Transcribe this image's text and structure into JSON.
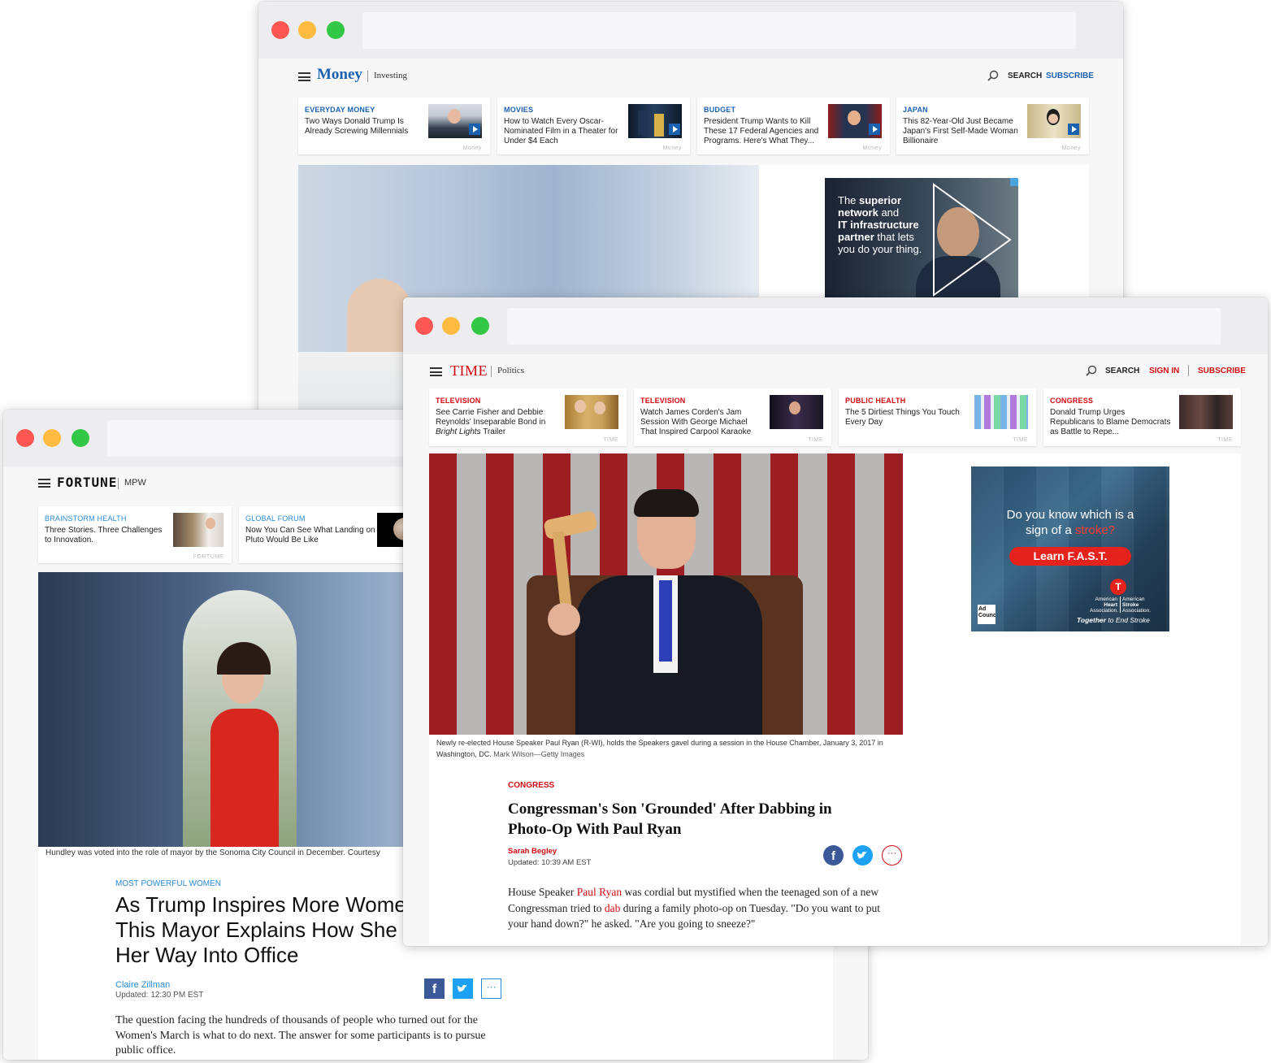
{
  "money": {
    "logo": "Money",
    "section": "Investing",
    "search_label": "SEARCH",
    "subscribe_label": "SUBSCRIBE",
    "cards": [
      {
        "kicker": "EVERYDAY MONEY",
        "headline": "Two Ways Donald Trump Is Already Screwing Millennials",
        "source": "Money"
      },
      {
        "kicker": "MOVIES",
        "headline": "How to Watch Every Oscar-Nominated Film in a Theater for Under $4 Each",
        "source": "Money"
      },
      {
        "kicker": "BUDGET",
        "headline": "President Trump Wants to Kill These 17 Federal Agencies and Programs. Here's What They...",
        "source": "Money"
      },
      {
        "kicker": "JAPAN",
        "headline": "This 82-Year-Old Just Became Japan's First Self-Made Woman Billionaire",
        "source": "Money"
      }
    ],
    "ad": {
      "line1": "The ",
      "line1b": "superior",
      "line2": "network",
      "line2b": " and",
      "line3": "IT infrastructure",
      "line4": "partner",
      "line4b": " that lets",
      "line5": "you do your thing."
    }
  },
  "fortune": {
    "logo": "FORTUNE",
    "section": "MPW",
    "cards": [
      {
        "kicker": "BRAINSTORM HEALTH",
        "headline": "Three Stories. Three Challenges to Innovation.",
        "source": "FORTUNE"
      },
      {
        "kicker": "GLOBAL FORUM",
        "headline": "Now You Can See What Landing on Pluto Would Be Like",
        "source": "FORTUNE"
      }
    ],
    "caption": "Hundley was voted into the role of mayor by the Sonoma City Council in December.  Courtesy",
    "kicker": "MOST POWERFUL WOMEN",
    "title_line1": "As Trump Inspires More Wome",
    "title_line2": "This Mayor Explains How She",
    "title_line3": "Her Way Into Office",
    "author": "Claire Zillman",
    "updated": "Updated: 12:30 PM EST",
    "body": "The question facing the hundreds of thousands of people who turned out for the Women's March is what to do next. The answer for some participants is to pursue public office."
  },
  "time": {
    "logo": "TIME",
    "section": "Politics",
    "search_label": "SEARCH",
    "signin_label": "SIGN IN",
    "subscribe_label": "SUBSCRIBE",
    "cards": [
      {
        "kicker": "TELEVISION",
        "headline_a": "See Carrie Fisher and Debbie Reynolds' Inseparable Bond in ",
        "headline_em": "Bright Lights",
        "headline_b": " Trailer",
        "source": "TIME"
      },
      {
        "kicker": "TELEVISION",
        "headline": "Watch James Corden's Jam Session With George Michael That Inspired Carpool Karaoke",
        "source": "TIME"
      },
      {
        "kicker": "PUBLIC HEALTH",
        "headline": "The 5 Dirtiest Things You Touch Every Day",
        "source": "TIME"
      },
      {
        "kicker": "CONGRESS",
        "headline": "Donald Trump Urges Republicans to Blame Democrats as Battle to Repe...",
        "source": "TIME"
      }
    ],
    "caption": "Newly re-elected House Speaker Paul Ryan (R-WI), holds the Speakers gavel during a session in the House Chamber, January 3, 2017 in Washington, DC.",
    "credit": "Mark Wilson—Getty Images",
    "kicker": "CONGRESS",
    "title_line1": "Congressman's Son 'Grounded' After Dabbing in",
    "title_line2": "Photo-Op With Paul Ryan",
    "author": "Sarah Begley",
    "updated": "Updated: 10:39 AM EST",
    "body_1": "House Speaker ",
    "body_link1": "Paul Ryan",
    "body_2": " was cordial but mystified when the teenaged son of a new Congressman tried to ",
    "body_link2": "dab",
    "body_3": " during a family photo-op on Tuesday. \"Do you want to put your hand down?\" he asked. \"Are you going to sneeze?\"",
    "ad": {
      "q1": "Do you know which is a",
      "q2a": "sign of a ",
      "q2b": "stroke?",
      "button": "Learn F.A.S.T.",
      "aha1": "American",
      "aha2": "Heart",
      "aha3": "Association.",
      "asa1": "American",
      "asa2": "Stroke",
      "asa3": "Association.",
      "adcouncil": "Ad Council",
      "tag_a": "Together",
      "tag_b": " to End Stroke"
    }
  },
  "colors": {
    "money_blue": "#1a62b0",
    "time_red": "#d10a10",
    "fortune_blue": "#2b8ad6",
    "chrome": "#ededf0"
  }
}
